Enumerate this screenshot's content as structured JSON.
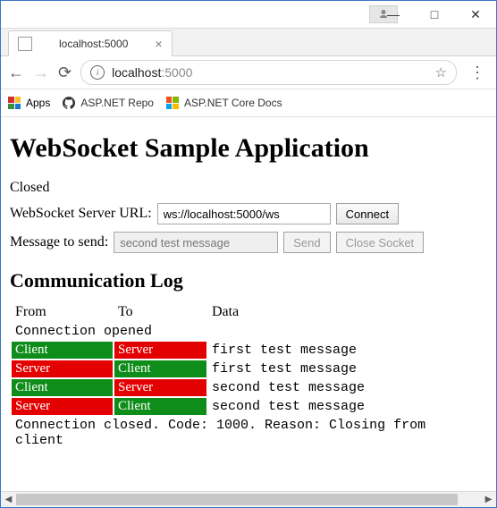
{
  "browser": {
    "tab_title": "localhost:5000",
    "url_host": "localhost",
    "url_port_path": ":5000",
    "apps_label": "Apps",
    "bookmarks": [
      {
        "label": "ASP.NET Repo",
        "icon": "github"
      },
      {
        "label": "ASP.NET Core Docs",
        "icon": "microsoft"
      }
    ]
  },
  "page": {
    "heading": "WebSocket Sample Application",
    "state_label": "Closed",
    "url_label": "WebSocket Server URL:",
    "url_value": "ws://localhost:5000/ws",
    "connect_label": "Connect",
    "msg_label": "Message to send:",
    "msg_value": "second test message",
    "send_label": "Send",
    "close_label": "Close Socket",
    "log_heading": "Communication Log",
    "log_headers": {
      "from": "From",
      "to": "To",
      "data": "Data"
    },
    "log": [
      {
        "kind": "info",
        "text": "Connection opened"
      },
      {
        "kind": "msg",
        "from": "Client",
        "to": "Server",
        "data": "first test message"
      },
      {
        "kind": "msg",
        "from": "Server",
        "to": "Client",
        "data": "first test message"
      },
      {
        "kind": "msg",
        "from": "Client",
        "to": "Server",
        "data": "second test message"
      },
      {
        "kind": "msg",
        "from": "Server",
        "to": "Client",
        "data": "second test message"
      },
      {
        "kind": "info",
        "text": "Connection closed. Code: 1000. Reason: Closing from client"
      }
    ]
  }
}
